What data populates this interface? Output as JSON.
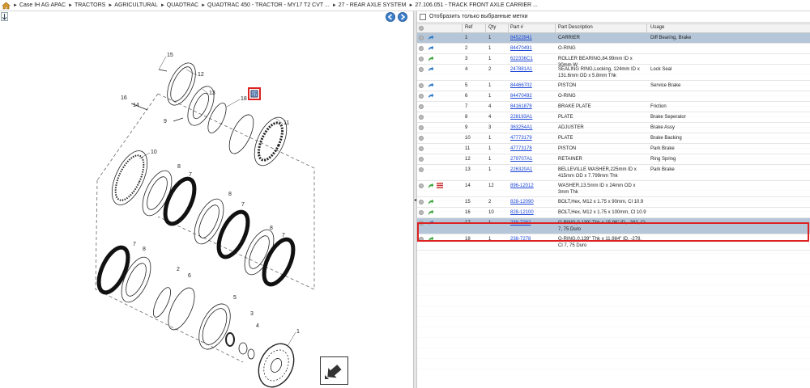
{
  "breadcrumb": [
    "Case IH AG APAC",
    "TRACTORS",
    "AGRICULTURAL",
    "QUADTRAC",
    "QUADTRAC 450 - TRACTOR - MY17 T2 CVT ...",
    "27 - REAR AXLE SYSTEM",
    "27.106.051 - TRACK FRONT AXLE CARRIER ..."
  ],
  "filter": {
    "label": "Отобразить только выбранные метки"
  },
  "columns": [
    "Ref",
    "Qty",
    "Part #",
    "Part Description",
    "Usage"
  ],
  "colors": {
    "selection": "#b4c6d8",
    "highlight": "#dd2222",
    "link": "#1a44d6"
  },
  "parts": [
    {
      "ref": "1",
      "qty": "1",
      "part": "84523941",
      "desc": "CARRIER",
      "usage": "Diff Bearing, Brake",
      "icon": "blue-arrow-icon",
      "sel": true
    },
    {
      "ref": "2",
      "qty": "1",
      "part": "84470491",
      "desc": "O-RING",
      "usage": "",
      "icon": "blue-arrow-icon"
    },
    {
      "ref": "3",
      "qty": "1",
      "part": "622336C1",
      "desc": "ROLLER BEARING,84.99mm ID x 30mm W",
      "usage": "",
      "icon": "green-arrow-icon"
    },
    {
      "ref": "4",
      "qty": "2",
      "part": "247881A1",
      "desc": "SEALING RING,Locking, 124mm ID x 131.6mm OD x 5.8mm Thk",
      "usage": "Lock Seal",
      "icon": "blue-arrow-icon"
    },
    {
      "ref": "5",
      "qty": "1",
      "part": "84466702",
      "desc": "PISTON",
      "usage": "Service Brake",
      "icon": "blue-arrow-icon"
    },
    {
      "ref": "6",
      "qty": "1",
      "part": "84470492",
      "desc": "O-RING",
      "usage": "",
      "icon": "blue-arrow-icon"
    },
    {
      "ref": "7",
      "qty": "4",
      "part": "84161878",
      "desc": "BRAKE PLATE",
      "usage": "Friction",
      "icon": ""
    },
    {
      "ref": "8",
      "qty": "4",
      "part": "228193A1",
      "desc": "PLATE",
      "usage": "Brake Seperator",
      "icon": ""
    },
    {
      "ref": "9",
      "qty": "3",
      "part": "363254A1",
      "desc": "ADJUSTER",
      "usage": "Brake Assy",
      "icon": ""
    },
    {
      "ref": "10",
      "qty": "1",
      "part": "47773179",
      "desc": "PLATE",
      "usage": "Brake Backing",
      "icon": ""
    },
    {
      "ref": "11",
      "qty": "1",
      "part": "47773178",
      "desc": "PISTON",
      "usage": "Park Brake",
      "icon": ""
    },
    {
      "ref": "12",
      "qty": "1",
      "part": "279707A1",
      "desc": "RETAINER",
      "usage": "Ring Spring",
      "icon": ""
    },
    {
      "ref": "13",
      "qty": "1",
      "part": "226320A1",
      "desc": "BELLEVILLE WASHER,225mm ID x 415mm OD x 7.799mm Thk",
      "usage": "Park Brake",
      "icon": ""
    },
    {
      "ref": "14",
      "qty": "12",
      "part": "896-12012",
      "desc": "WASHER,13.5mm ID x 24mm OD x 3mm Thk",
      "usage": "",
      "icon": "green-arrow-icon",
      "extra": "list-icon"
    },
    {
      "ref": "15",
      "qty": "2",
      "part": "828-12090",
      "desc": "BOLT,Hex, M12 x 1.75 x 90mm, Cl 10.9",
      "usage": "",
      "icon": "green-arrow-icon"
    },
    {
      "ref": "16",
      "qty": "10",
      "part": "828-12100",
      "desc": "BOLT,Hex, M12 x 1.75 x 100mm, Cl 10.9",
      "usage": "",
      "icon": "green-arrow-icon"
    },
    {
      "ref": "17",
      "qty": "1",
      "part": "238-7282",
      "desc": "O-RING,0.139\" Thk x 15.96\" ID, -282, Cl 7, 75 Duro",
      "usage": "",
      "icon": "blue-arrow-icon",
      "sel": true,
      "hl": true
    },
    {
      "ref": "18",
      "qty": "1",
      "part": "238-7278",
      "desc": "O-RING,0.139\" Thk x 11.984\" ID, -278, Cl 7, 75 Duro",
      "usage": "",
      "icon": "green-arrow-icon"
    }
  ],
  "callouts": [
    "1",
    "2",
    "3",
    "4",
    "5",
    "6",
    "7",
    "8",
    "9",
    "10",
    "11",
    "12",
    "13",
    "14",
    "15",
    "16",
    "17",
    "18"
  ]
}
